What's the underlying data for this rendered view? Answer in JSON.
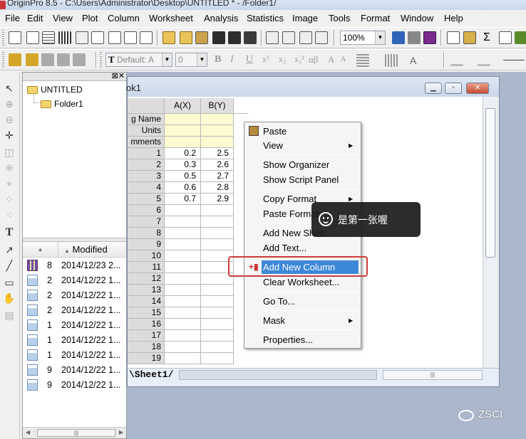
{
  "window": {
    "title": "OriginPro 8.5 - C:\\Users\\Administrator\\Desktop\\UNTITLED * - /Folder1/"
  },
  "menubar": [
    "File",
    "Edit",
    "View",
    "Plot",
    "Column",
    "Worksheet",
    "Analysis",
    "Statistics",
    "Image",
    "Tools",
    "Format",
    "Window",
    "Help"
  ],
  "toolbar": {
    "zoom": "100%",
    "font_combo": "Default: A",
    "size_combo": "0",
    "format_labels": [
      "B",
      "I",
      "U",
      "x²",
      "x₂",
      "x₁²",
      "αβ",
      "A",
      "A"
    ]
  },
  "explorer": {
    "tree": {
      "root": "UNTITLED",
      "child": "Folder1"
    },
    "list_header": "Modified",
    "list_items": [
      {
        "icon": "workbook-icon",
        "c1": "8",
        "date": "2014/12/23 2..."
      },
      {
        "icon": "graph-icon",
        "c1": "2",
        "date": "2014/12/22 1..."
      },
      {
        "icon": "graph-icon",
        "c1": "2",
        "date": "2014/12/22 1..."
      },
      {
        "icon": "graph-icon",
        "c1": "2",
        "date": "2014/12/22 1..."
      },
      {
        "icon": "graph-icon",
        "c1": "1",
        "date": "2014/12/22 1..."
      },
      {
        "icon": "graph-icon",
        "c1": "1",
        "date": "2014/12/22 1..."
      },
      {
        "icon": "graph-icon",
        "c1": "1",
        "date": "2014/12/22 1..."
      },
      {
        "icon": "graph-icon",
        "c1": "9",
        "date": "2014/12/22 1..."
      },
      {
        "icon": "graph-icon",
        "c1": "9",
        "date": "2014/12/22 1..."
      }
    ]
  },
  "workbook": {
    "title_fragment": "ok1",
    "columns": [
      "A(X)",
      "B(Y)"
    ],
    "meta_rows": [
      "g Name",
      "Units",
      "mments"
    ],
    "rows": [
      {
        "n": "1",
        "a": "0.2",
        "b": "2.5"
      },
      {
        "n": "2",
        "a": "0.3",
        "b": "2.6"
      },
      {
        "n": "3",
        "a": "0.5",
        "b": "2.7"
      },
      {
        "n": "4",
        "a": "0.6",
        "b": "2.8"
      },
      {
        "n": "5",
        "a": "0.7",
        "b": "2.9"
      },
      {
        "n": "6",
        "a": "",
        "b": ""
      },
      {
        "n": "7",
        "a": "",
        "b": ""
      },
      {
        "n": "8",
        "a": "",
        "b": ""
      },
      {
        "n": "9",
        "a": "",
        "b": ""
      },
      {
        "n": "10",
        "a": "",
        "b": ""
      },
      {
        "n": "11",
        "a": "",
        "b": ""
      },
      {
        "n": "12",
        "a": "",
        "b": ""
      },
      {
        "n": "13",
        "a": "",
        "b": ""
      },
      {
        "n": "14",
        "a": "",
        "b": ""
      },
      {
        "n": "15",
        "a": "",
        "b": ""
      },
      {
        "n": "16",
        "a": "",
        "b": ""
      },
      {
        "n": "17",
        "a": "",
        "b": ""
      },
      {
        "n": "18",
        "a": "",
        "b": ""
      },
      {
        "n": "19",
        "a": "",
        "b": ""
      }
    ],
    "sheet_tab": "\\Sheet1/"
  },
  "context_menu": {
    "items": [
      "Paste",
      "View",
      "Show Organizer",
      "Show Script Panel",
      "Copy Format",
      "Paste Format",
      "Add New Sheet",
      "Add Text...",
      "Add New Column",
      "Clear Worksheet...",
      "Go To...",
      "Mask",
      "Properties..."
    ],
    "highlighted": "Add New Column",
    "highlight_color": "#3d88d8",
    "outline_color": "#cc3b3b"
  },
  "toast": {
    "message": "是第一张喔"
  },
  "watermark": {
    "text": "ZSCI"
  }
}
